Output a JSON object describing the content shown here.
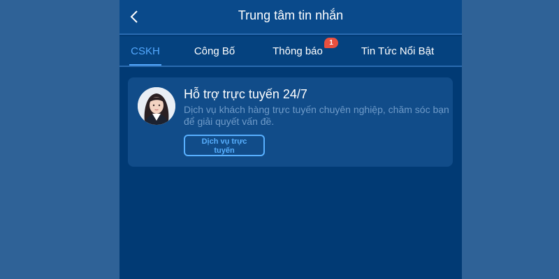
{
  "header": {
    "title": "Trung tâm tin nhắn",
    "back_icon": "chevron-left-icon"
  },
  "tabs": [
    {
      "label": "CSKH",
      "active": true
    },
    {
      "label": "Công Bố",
      "active": false
    },
    {
      "label": "Thông báo",
      "active": false,
      "badge": "1"
    },
    {
      "label": "Tin Tức Nổi Bật",
      "active": false
    }
  ],
  "support_card": {
    "title": "Hỗ trợ trực tuyến 24/7",
    "description": "Dịch vụ khách hàng trực tuyến chuyên nghiệp, chăm sóc bạn để giải quyết vấn đề.",
    "button_label": "Dịch vụ trực tuyến",
    "avatar_icon": "support-agent-avatar"
  },
  "colors": {
    "page_background": "#2f6297",
    "panel_background": "#013a74",
    "header_background": "#0a4a8b",
    "active_tab": "#54a9ff",
    "badge": "#e9503f",
    "card_background": "#114c89",
    "description_text": "#6f9bc9"
  }
}
